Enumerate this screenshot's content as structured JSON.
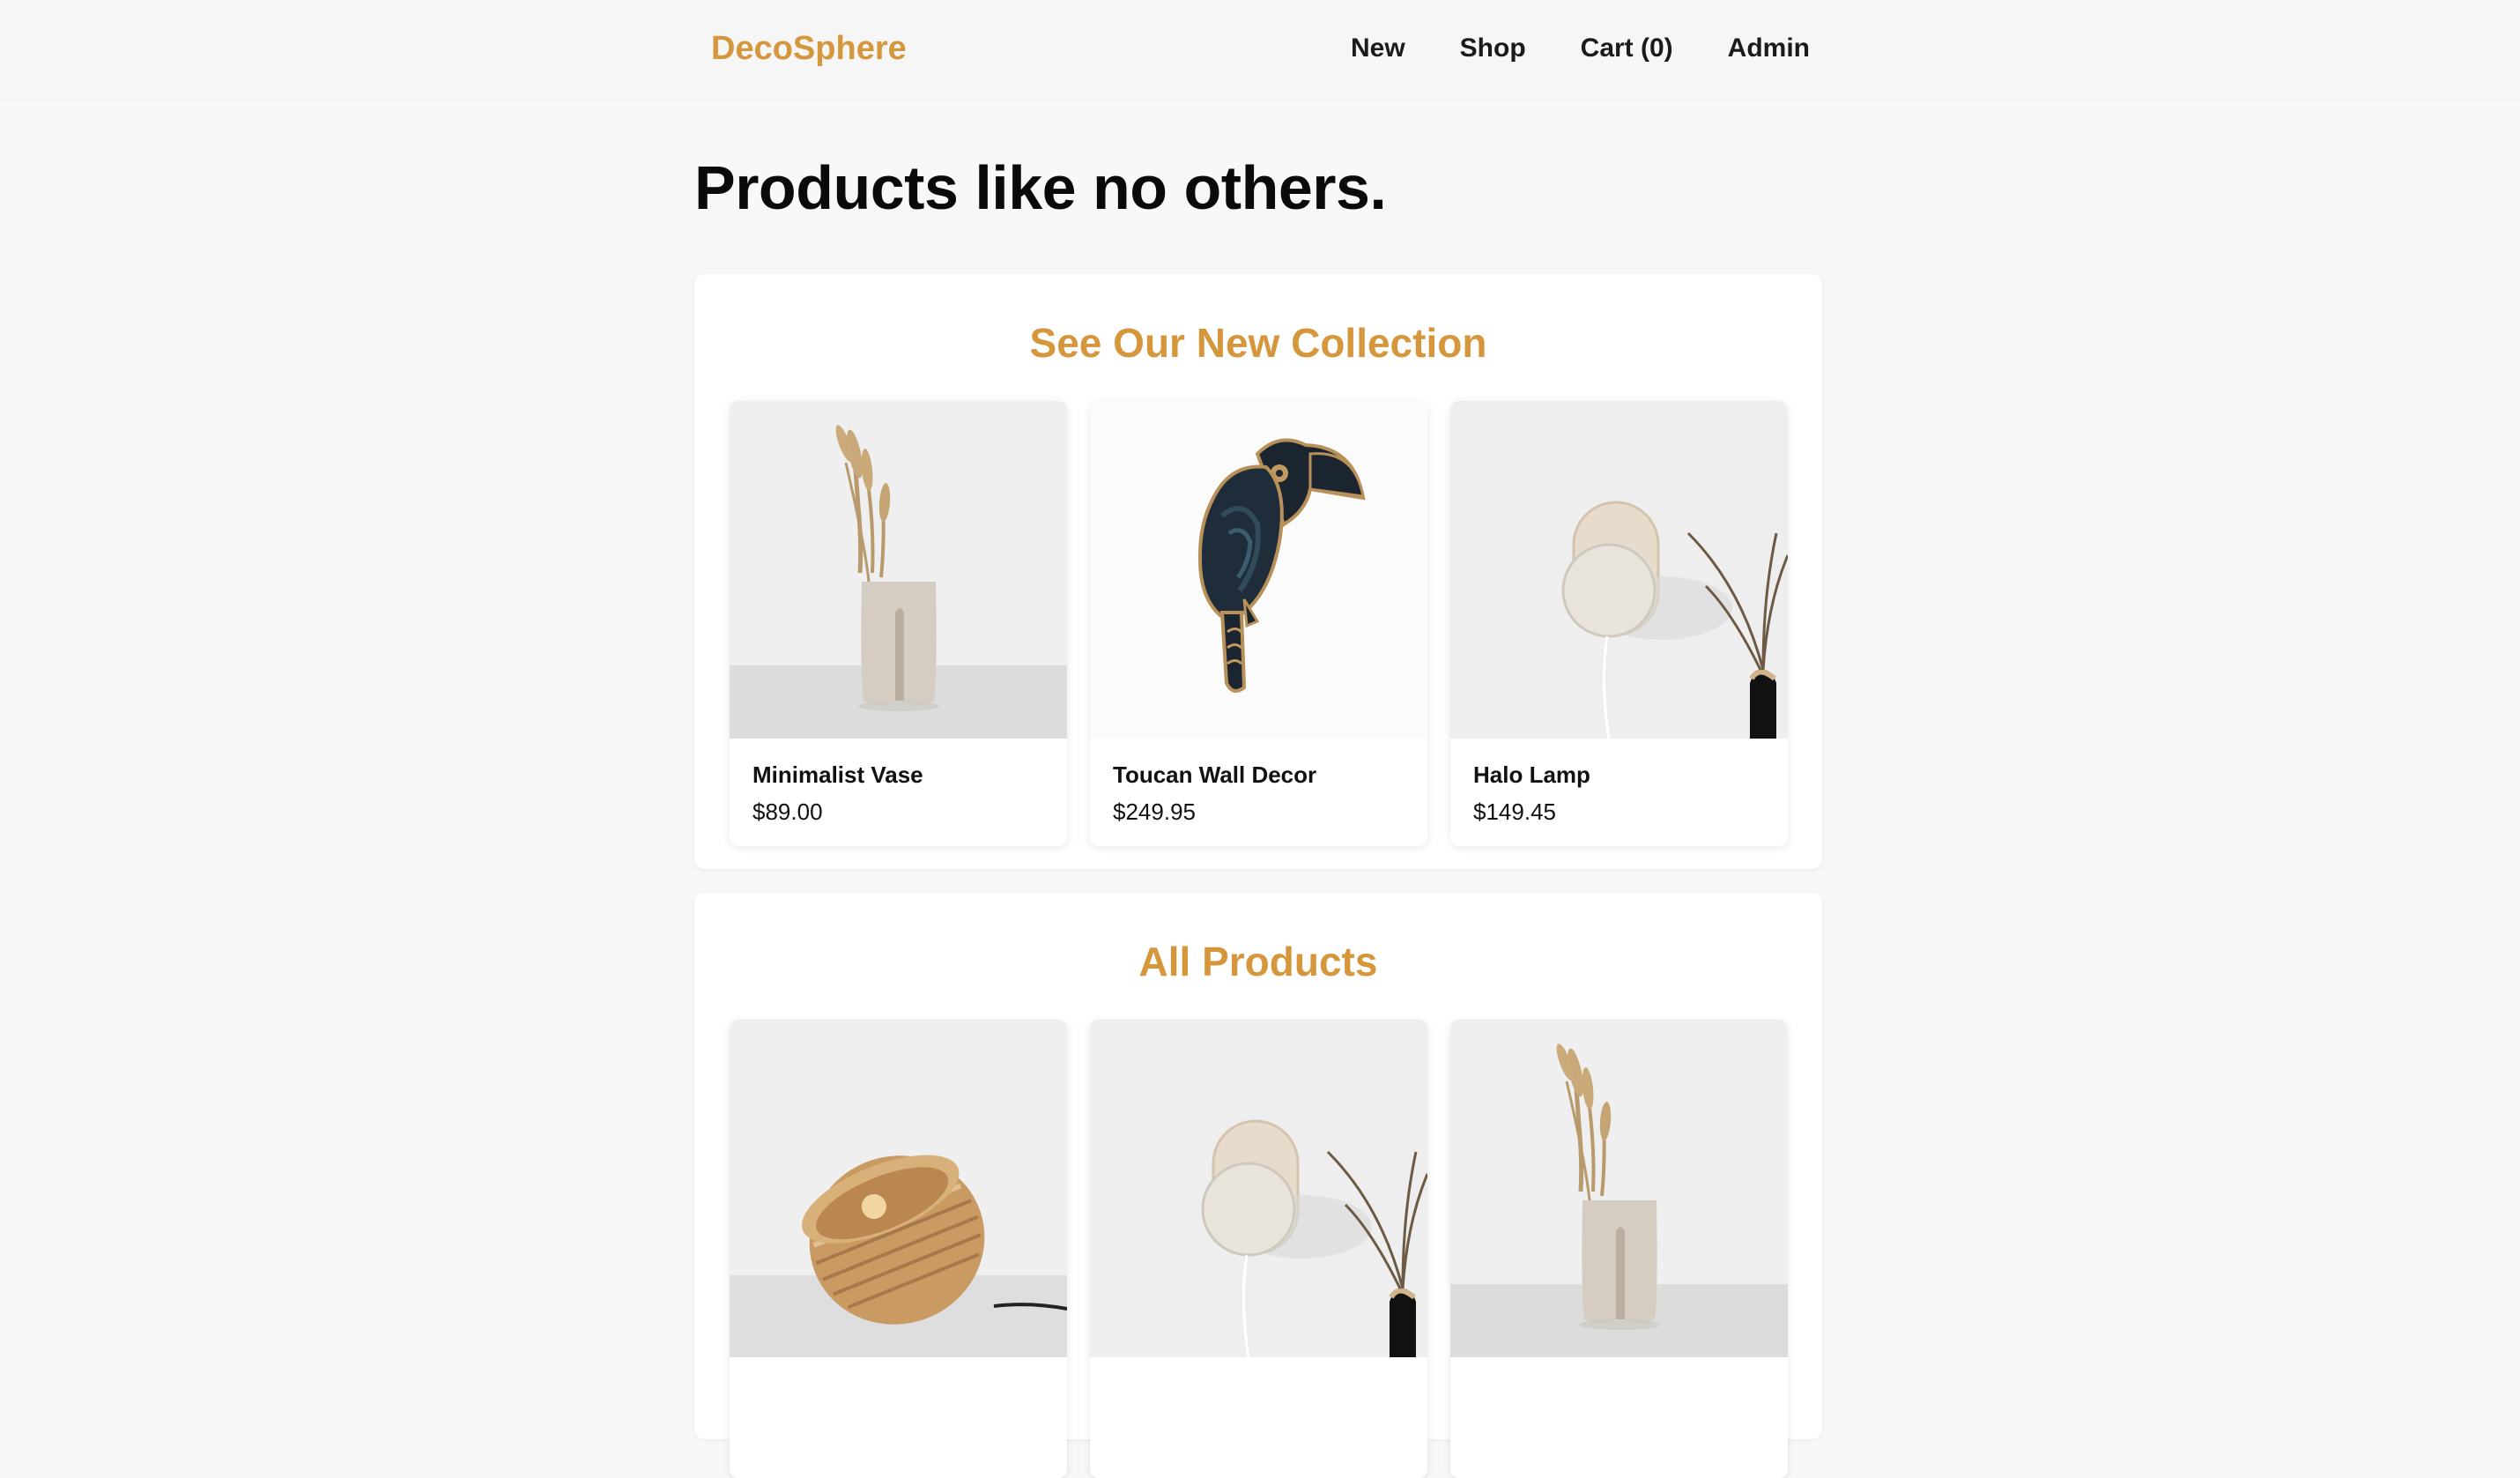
{
  "header": {
    "logo": "DecoSphere",
    "nav": [
      "New",
      "Shop",
      "Cart (0)",
      "Admin"
    ]
  },
  "hero": {
    "headline": "Products like no others."
  },
  "new_collection": {
    "title": "See Our New Collection",
    "products": [
      {
        "name": "Minimalist Vase",
        "price": "$89.00",
        "image": "vase-with-dried-grass"
      },
      {
        "name": "Toucan Wall Decor",
        "price": "$249.95",
        "image": "toucan-wall-art"
      },
      {
        "name": "Halo Lamp",
        "price": "$149.45",
        "image": "halo-wall-lamp"
      }
    ]
  },
  "all_products": {
    "title": "All Products",
    "products": [
      {
        "image": "sphere-table-lamp"
      },
      {
        "image": "halo-wall-lamp"
      },
      {
        "image": "vase-with-dried-grass"
      }
    ]
  },
  "colors": {
    "accent": "#d6973c",
    "background": "#f9f8f6",
    "header": "#f6f6f6",
    "card": "#ffffff"
  }
}
